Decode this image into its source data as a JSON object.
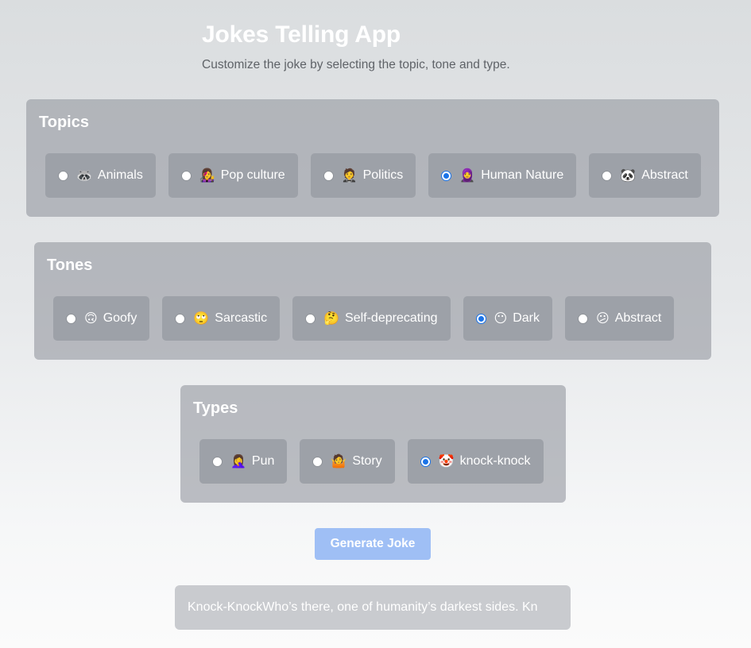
{
  "app": {
    "title": "Jokes Telling App",
    "subtitle": "Customize the joke by selecting the topic, tone and type."
  },
  "topics": {
    "title": "Topics",
    "selected": "Human Nature",
    "options": [
      {
        "label": "Animals",
        "emoji": "🦝",
        "icon": "raccoon-icon",
        "checked": false
      },
      {
        "label": "Pop culture",
        "emoji": "👩‍🎤",
        "icon": "singer-icon",
        "checked": false
      },
      {
        "label": "Politics",
        "emoji": "🤵",
        "icon": "person-in-suit-icon",
        "checked": false
      },
      {
        "label": "Human Nature",
        "emoji": "🧕",
        "icon": "person-headscarf-icon",
        "checked": true
      },
      {
        "label": "Abstract",
        "emoji": "🐼",
        "icon": "panda-icon",
        "checked": false
      }
    ]
  },
  "tones": {
    "title": "Tones",
    "selected": "Dark",
    "options": [
      {
        "label": "Goofy",
        "emoji": "🙃",
        "icon": "upside-down-face-icon",
        "checked": false
      },
      {
        "label": "Sarcastic",
        "emoji": "🙄",
        "icon": "eye-roll-face-icon",
        "checked": false
      },
      {
        "label": "Self-deprecating",
        "emoji": "🤔",
        "icon": "thinking-face-icon",
        "checked": false
      },
      {
        "label": "Dark",
        "emoji": "😶",
        "icon": "no-mouth-face-icon",
        "checked": true
      },
      {
        "label": "Abstract",
        "emoji": "😕",
        "icon": "confused-face-icon",
        "checked": false
      }
    ]
  },
  "types": {
    "title": "Types",
    "selected": "knock-knock",
    "options": [
      {
        "label": "Pun",
        "emoji": "🤦‍♀️",
        "icon": "facepalm-icon",
        "checked": false
      },
      {
        "label": "Story",
        "emoji": "🤷",
        "icon": "shrug-icon",
        "checked": false
      },
      {
        "label": "knock-knock",
        "emoji": "🤡",
        "icon": "clown-face-icon",
        "checked": true
      }
    ]
  },
  "generate": {
    "label": "Generate Joke"
  },
  "joke": {
    "text": "Knock-KnockWho’s there, one of humanity’s darkest sides. Kn"
  },
  "colors": {
    "accent": "#1a73e8",
    "button_bg": "#9fbff5",
    "option_bg": "#9da1a8"
  }
}
